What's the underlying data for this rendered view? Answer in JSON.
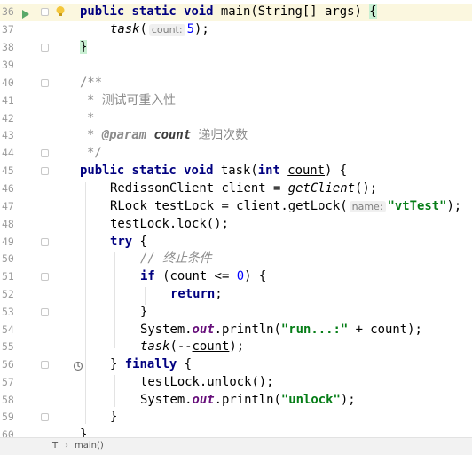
{
  "editor": {
    "line_numbers": [
      "36",
      "37",
      "38",
      "39",
      "40",
      "41",
      "42",
      "43",
      "44",
      "45",
      "46",
      "47",
      "48",
      "49",
      "50",
      "51",
      "52",
      "53",
      "54",
      "55",
      "56",
      "57",
      "58",
      "59",
      "60"
    ],
    "code": {
      "l36": {
        "kw1": "public static void",
        "name": "main(String[] args)",
        "brace": "{"
      },
      "l37": {
        "call": "task",
        "open": "(",
        "hint": "count:",
        "num": "5",
        "close": ");"
      },
      "l38": {
        "brace": "}"
      },
      "l40": {
        "text": "/**"
      },
      "l41": {
        "text": "* 测试可重入性"
      },
      "l42": {
        "text": "*"
      },
      "l43": {
        "star": "*",
        "tag": "@param",
        "param": "count",
        "desc": "递归次数"
      },
      "l44": {
        "text": "*/"
      },
      "l45": {
        "kw1": "public static void",
        "name": "task(",
        "kw2": "int",
        "param": "count",
        "close": ") {"
      },
      "l46": {
        "type": "RedissonClient client =",
        "call": "getClient",
        "end": "();"
      },
      "l47": {
        "type": "RLock testLock = client.getLock(",
        "hint": "name:",
        "str": "\"vtTest\"",
        "end": ");"
      },
      "l48": {
        "text": "testLock.lock();"
      },
      "l49": {
        "kw": "try",
        "rest": "{"
      },
      "l50": {
        "text": "// 终止条件"
      },
      "l51": {
        "kw": "if",
        "a": "(count <=",
        "num": "0",
        "b": ") {"
      },
      "l52": {
        "kw": "return",
        "rest": ";"
      },
      "l53": {
        "text": "}"
      },
      "l54": {
        "a": "System.",
        "field": "out",
        "b": ".println(",
        "str": "\"run...:\"",
        "c": "+ count);"
      },
      "l55": {
        "call": "task",
        "a": "(--",
        "var": "count",
        "b": ");"
      },
      "l56": {
        "a": "}",
        "kw": "finally",
        "b": "{"
      },
      "l57": {
        "text": "testLock.unlock();"
      },
      "l58": {
        "a": "System.",
        "field": "out",
        "b": ".println(",
        "str": "\"unlock\"",
        "c": ");"
      },
      "l59": {
        "text": "}"
      },
      "l60": {
        "text": "}"
      }
    }
  },
  "gutter_icons": {
    "run": "run-arrow-icon",
    "bulb": "lightbulb-icon",
    "recursion": "recursive-call-icon"
  },
  "status": {
    "class_label": "T",
    "separator": "›",
    "method_label": "main()"
  },
  "colors": {
    "keyword": "#000080",
    "string": "#067d17",
    "number": "#0000ff",
    "comment": "#8c8c8c",
    "static_field": "#660e7a",
    "current_line": "#fbf7df",
    "brace_match": "#c9f0d3"
  }
}
